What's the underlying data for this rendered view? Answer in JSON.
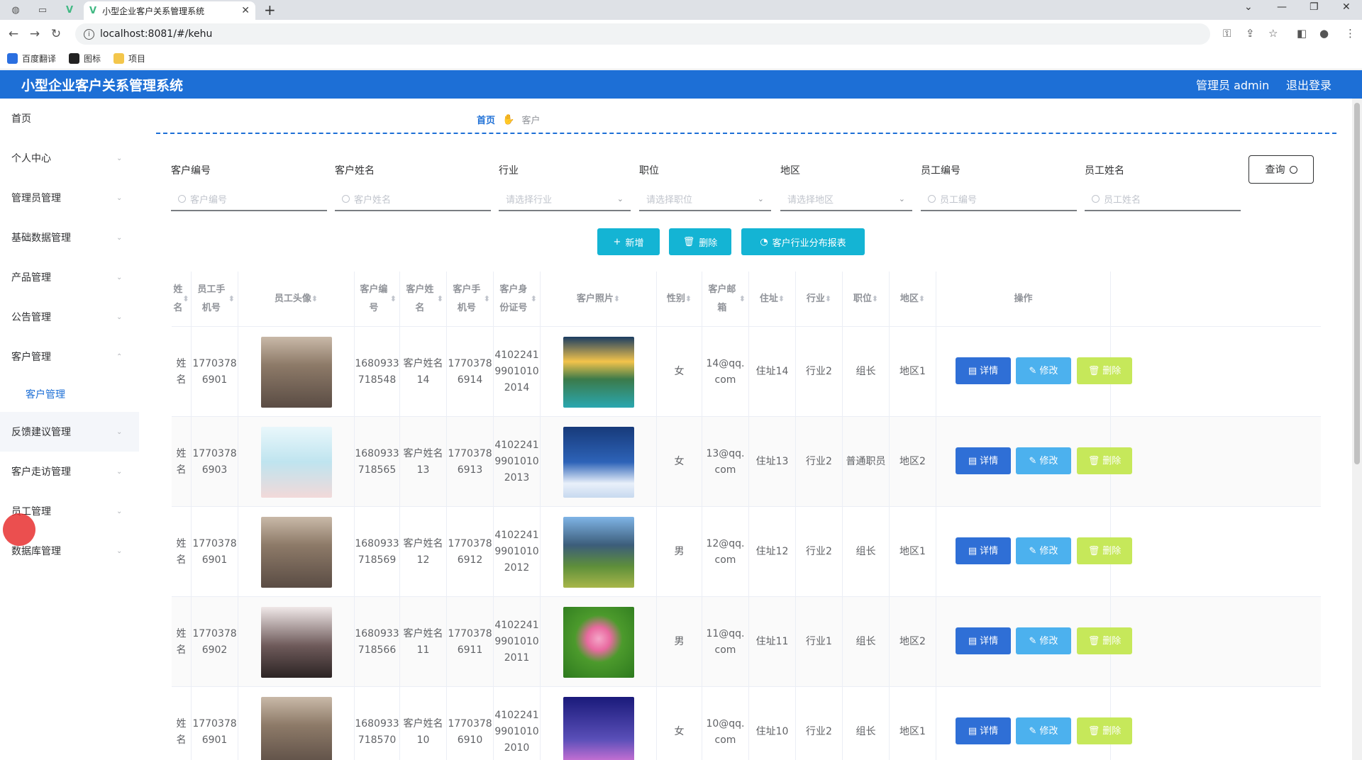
{
  "browser": {
    "tab_title": "小型企业客户关系管理系统",
    "url": "localhost:8081/#/kehu",
    "bookmarks": [
      "百度翻译",
      "图标",
      "项目"
    ]
  },
  "header": {
    "title": "小型企业客户关系管理系统",
    "user": "管理员 admin",
    "logout": "退出登录"
  },
  "sidebar": {
    "items": [
      "首页",
      "个人中心",
      "管理员管理",
      "基础数据管理",
      "产品管理",
      "公告管理",
      "客户管理",
      "客户管理",
      "反馈建议管理",
      "客户走访管理",
      "员工管理",
      "数据库管理"
    ]
  },
  "breadcrumb": {
    "home": "首页",
    "current": "客户"
  },
  "filters": [
    {
      "label": "客户编号",
      "placeholder": "客户编号"
    },
    {
      "label": "客户姓名",
      "placeholder": "客户姓名"
    },
    {
      "label": "行业",
      "placeholder": "请选择行业"
    },
    {
      "label": "职位",
      "placeholder": "请选择职位"
    },
    {
      "label": "地区",
      "placeholder": "请选择地区"
    },
    {
      "label": "员工编号",
      "placeholder": "员工编号"
    },
    {
      "label": "员工姓名",
      "placeholder": "员工姓名"
    }
  ],
  "query_label": "查询",
  "actions": {
    "add": "新增",
    "delete": "删除",
    "report": "客户行业分布报表"
  },
  "table": {
    "headers": [
      "姓名",
      "员工手机号",
      "员工头像",
      "客户编号",
      "客户姓名",
      "客户手机号",
      "客户身份证号",
      "客户照片",
      "性别",
      "客户邮箱",
      "住址",
      "行业",
      "职位",
      "地区",
      "操作"
    ],
    "rows": [
      {
        "name": "姓名",
        "emp_phone": "1770378 6901",
        "cust_no": "1680933 718548",
        "cust_name": "客户姓名 14",
        "cust_phone": "1770378 6914",
        "id_no": "4102241 9901010 2014",
        "gender": "女",
        "email": "14@qq. com",
        "addr": "住址14",
        "industry": "行业2",
        "position": "组长",
        "region": "地区1"
      },
      {
        "name": "姓名",
        "emp_phone": "1770378 6903",
        "cust_no": "1680933 718565",
        "cust_name": "客户姓名 13",
        "cust_phone": "1770378 6913",
        "id_no": "4102241 9901010 2013",
        "gender": "女",
        "email": "13@qq. com",
        "addr": "住址13",
        "industry": "行业2",
        "position": "普通职员",
        "region": "地区2"
      },
      {
        "name": "姓名",
        "emp_phone": "1770378 6901",
        "cust_no": "1680933 718569",
        "cust_name": "客户姓名 12",
        "cust_phone": "1770378 6912",
        "id_no": "4102241 9901010 2012",
        "gender": "男",
        "email": "12@qq. com",
        "addr": "住址12",
        "industry": "行业2",
        "position": "组长",
        "region": "地区1"
      },
      {
        "name": "姓名",
        "emp_phone": "1770378 6902",
        "cust_no": "1680933 718566",
        "cust_name": "客户姓名 11",
        "cust_phone": "1770378 6911",
        "id_no": "4102241 9901010 2011",
        "gender": "男",
        "email": "11@qq. com",
        "addr": "住址11",
        "industry": "行业1",
        "position": "组长",
        "region": "地区2"
      },
      {
        "name": "姓名",
        "emp_phone": "1770378 6901",
        "cust_no": "1680933 718570",
        "cust_name": "客户姓名 10",
        "cust_phone": "1770378 6910",
        "id_no": "4102241 9901010 2010",
        "gender": "女",
        "email": "10@qq. com",
        "addr": "住址10",
        "industry": "行业2",
        "position": "组长",
        "region": "地区1"
      }
    ],
    "op_labels": {
      "detail": "详情",
      "edit": "修改",
      "delete": "删除"
    }
  },
  "colors": {
    "primary": "#1d6fd6",
    "action": "#14b4d4",
    "detail": "#2f6fd6",
    "edit": "#4cb1ee",
    "delete": "#c6e85a"
  }
}
